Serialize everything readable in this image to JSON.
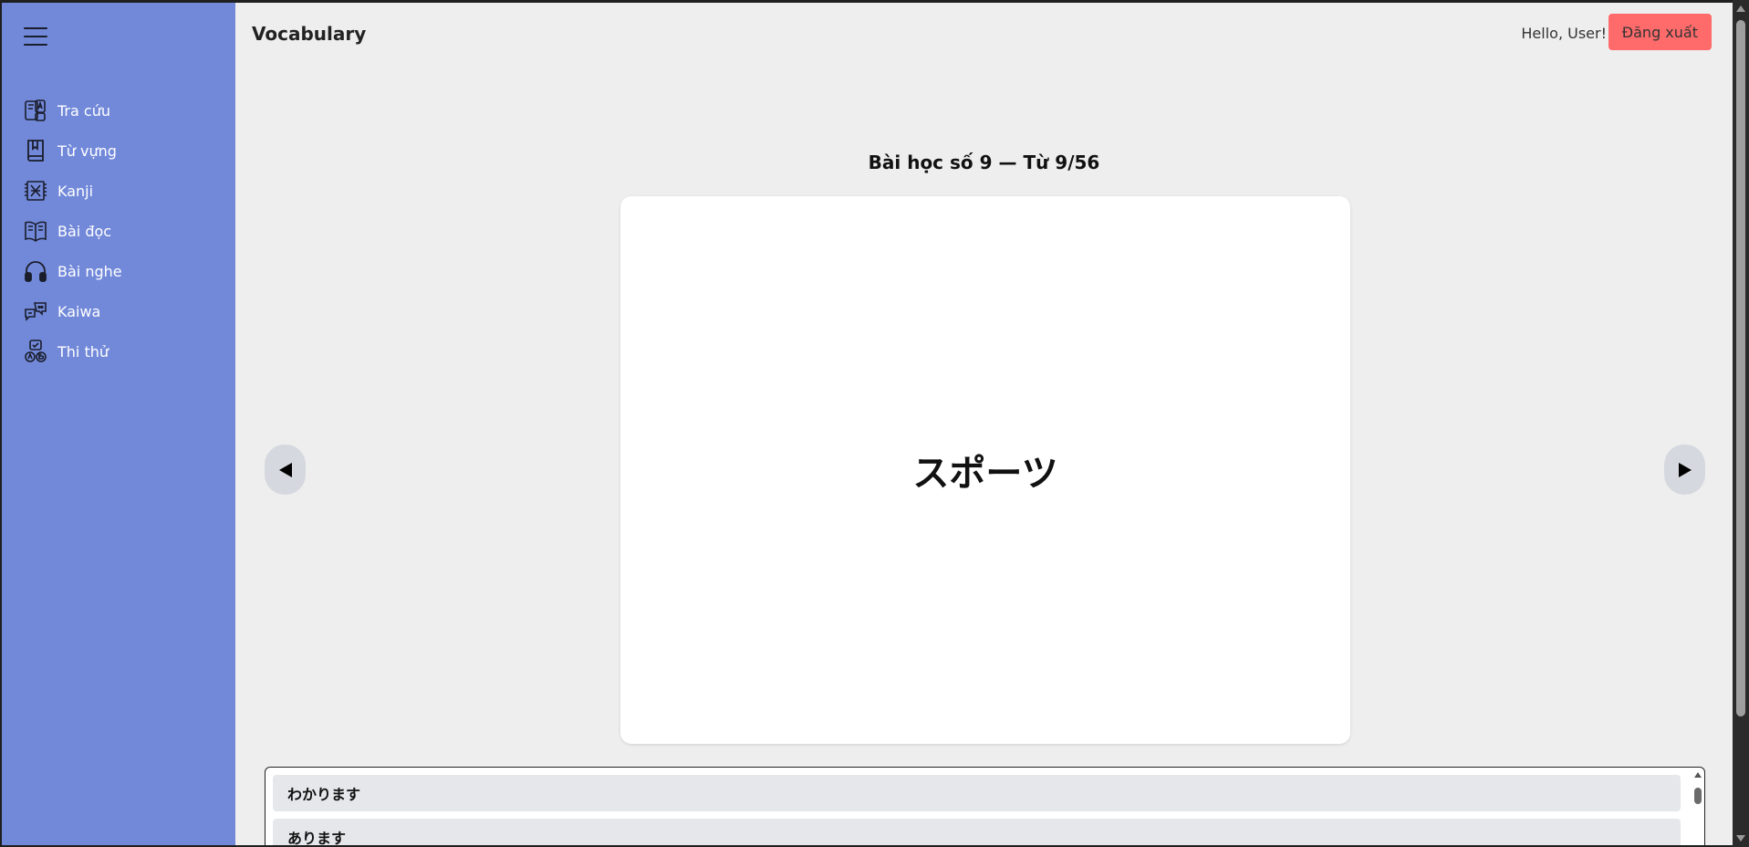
{
  "header": {
    "title": "Vocabulary",
    "greeting": "Hello, User!",
    "logout_label": "Đăng xuất"
  },
  "sidebar": {
    "items": [
      {
        "label": "Tra cứu",
        "icon": "dictionary-icon"
      },
      {
        "label": "Từ vựng",
        "icon": "book-icon"
      },
      {
        "label": "Kanji",
        "icon": "kanji-icon"
      },
      {
        "label": "Bài đọc",
        "icon": "open-book-icon"
      },
      {
        "label": "Bài nghe",
        "icon": "headphones-icon"
      },
      {
        "label": "Kaiwa",
        "icon": "conversation-icon"
      },
      {
        "label": "Thi thử",
        "icon": "exam-icon"
      }
    ]
  },
  "lesson": {
    "title": "Bài học số 9 — Từ 9/56",
    "card_word": "スポーツ"
  },
  "word_list": {
    "items": [
      "わかります",
      "あります"
    ]
  },
  "colors": {
    "sidebar_bg": "#7289da",
    "logout_bg": "#ff6b6b",
    "page_bg": "#eeeeee"
  }
}
